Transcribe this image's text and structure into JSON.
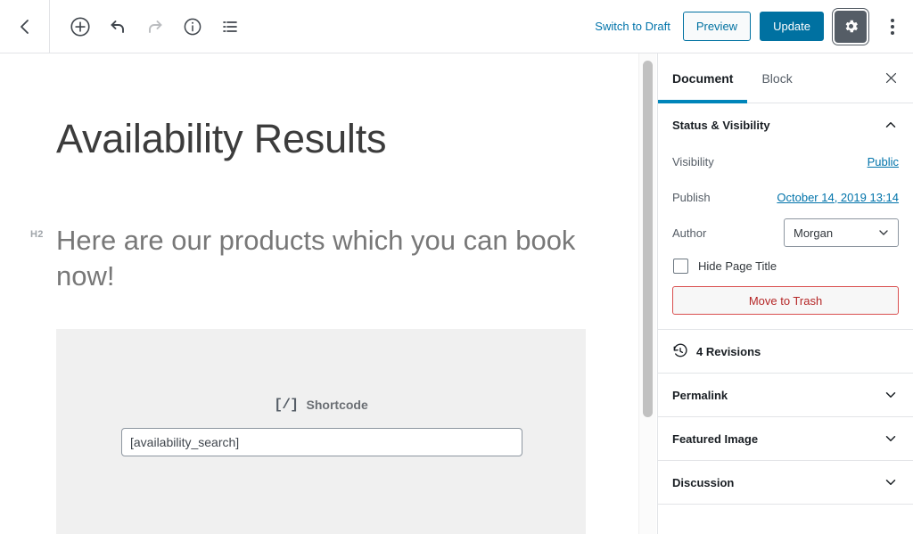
{
  "header": {
    "back_icon": "chevron-left-icon",
    "tools": [
      {
        "name": "add-block-button",
        "icon": "plus-circle-icon",
        "disabled": false
      },
      {
        "name": "undo-button",
        "icon": "undo-icon",
        "disabled": false
      },
      {
        "name": "redo-button",
        "icon": "redo-icon",
        "disabled": true
      },
      {
        "name": "content-info-button",
        "icon": "info-circle-icon",
        "disabled": false
      },
      {
        "name": "block-navigation-button",
        "icon": "list-view-icon",
        "disabled": false
      }
    ],
    "switch_to_draft_label": "Switch to Draft",
    "preview_label": "Preview",
    "update_label": "Update",
    "settings_icon": "gear-icon",
    "more_menu_icon": "vertical-ellipsis-icon",
    "accent_blue": "#0071a1",
    "link_blue": "#0073aa",
    "gear_button_bg": "#555d66"
  },
  "editor": {
    "title": "Availability Results",
    "heading_level_badge": "H2",
    "heading_text": "Here are our products which you can book now!",
    "shortcode_block": {
      "icon_glyph": "[/]",
      "label": "Shortcode",
      "value": "[availability_search]",
      "background": "#f0f0f0"
    }
  },
  "sidebar": {
    "tabs": [
      {
        "label": "Document",
        "active": true
      },
      {
        "label": "Block",
        "active": false
      }
    ],
    "close_icon": "close-icon",
    "status_panel": {
      "title": "Status & Visibility",
      "expanded": true,
      "chevron": "chevron-up-icon",
      "visibility_label": "Visibility",
      "visibility_value": "Public",
      "publish_label": "Publish",
      "publish_value": "October 14, 2019 13:14",
      "author_label": "Author",
      "author_value": "Morgan",
      "author_chevron": "chevron-down-icon",
      "hide_page_title_label": "Hide Page Title",
      "hide_page_title_checked": false,
      "trash_label": "Move to Trash",
      "trash_color": "#b52727"
    },
    "revisions": {
      "icon": "history-clock-icon",
      "label": "4 Revisions"
    },
    "panels": [
      {
        "label": "Permalink",
        "chevron": "chevron-down-icon"
      },
      {
        "label": "Featured Image",
        "chevron": "chevron-down-icon"
      },
      {
        "label": "Discussion",
        "chevron": "chevron-down-icon"
      }
    ]
  }
}
